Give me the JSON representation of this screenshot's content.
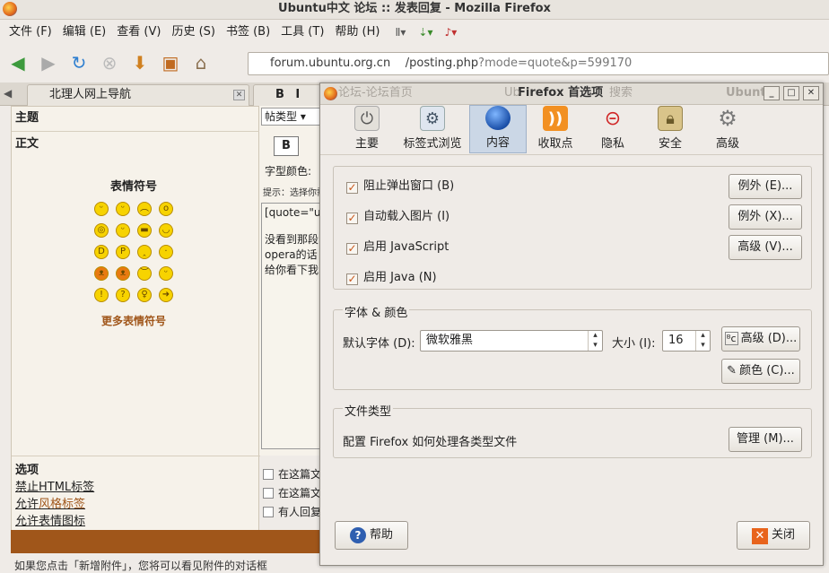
{
  "window": {
    "title": "Ubuntu中文 论坛 :: 发表回复 - Mozilla Firefox"
  },
  "menu": [
    "文件 (F)",
    "编辑 (E)",
    "查看 (V)",
    "历史 (S)",
    "书签 (B)",
    "工具 (T)",
    "帮助 (H)"
  ],
  "url": {
    "host": "forum.ubuntu.org.cn",
    "path": "/posting.php",
    "query": "?mode=quote&p=599170"
  },
  "tabs": [
    {
      "label": "北理人网上导航"
    },
    {
      "label": "B I T"
    },
    {
      "label": "论坛-论坛首页"
    },
    {
      "label": "Ub"
    },
    {
      "label": "搜索"
    },
    {
      "label": "Ubunt"
    }
  ],
  "form": {
    "subject_label": "主题",
    "body_label": "正文",
    "emoticons_title": "表情符号",
    "more_emoticons": "更多表情符号",
    "post_type": "帖类型",
    "bold_btn": "B",
    "font_color_label": "字型颜色:",
    "hint": "提示：选择你需",
    "editor_lines": [
      "[quote=\"ub",
      "没看到那段",
      "opera的话",
      "给你看下我"
    ],
    "options_label": "选项",
    "opt_html": "禁止HTML标签",
    "opt_bbcode_pre": "允许",
    "opt_bbcode_link": "风格标签",
    "opt_smilies": "允许表情图标",
    "right_checks": [
      "在这篇文",
      "在这篇文",
      "有人回复"
    ],
    "footer_text": "如果您点击「新增附件」，您将可以看见附件的对话框"
  },
  "dialog": {
    "title": "Firefox 首选项",
    "tabs": [
      {
        "label": "主要",
        "icon": "switch-icon"
      },
      {
        "label": "标签式浏览",
        "icon": "tabs-icon"
      },
      {
        "label": "内容",
        "icon": "globe-icon"
      },
      {
        "label": "收取点",
        "icon": "rss-icon"
      },
      {
        "label": "隐私",
        "icon": "mask-icon"
      },
      {
        "label": "安全",
        "icon": "lock-icon"
      },
      {
        "label": "高级",
        "icon": "gear-icon"
      }
    ],
    "selected_tab": "内容",
    "content": {
      "block_popups": "阻止弹出窗口 (B)",
      "load_images": "自动载入图片 (I)",
      "enable_js": "启用 JavaScript",
      "enable_java": "启用 Java (N)",
      "exceptions1": "例外 (E)...",
      "exceptions2": "例外 (X)...",
      "advanced_js": "高级 (V)...",
      "fonts_title": "字体 & 颜色",
      "default_font_label": "默认字体 (D):",
      "default_font_value": "微软雅黑",
      "size_label": "大小 (I):",
      "size_value": "16",
      "fonts_advanced": "高级 (D)...",
      "colors": "颜色 (C)...",
      "filetypes_title": "文件类型",
      "filetypes_desc": "配置 Firefox 如何处理各类型文件",
      "manage": "管理 (M)..."
    },
    "help": "帮助",
    "close": "关闭"
  }
}
